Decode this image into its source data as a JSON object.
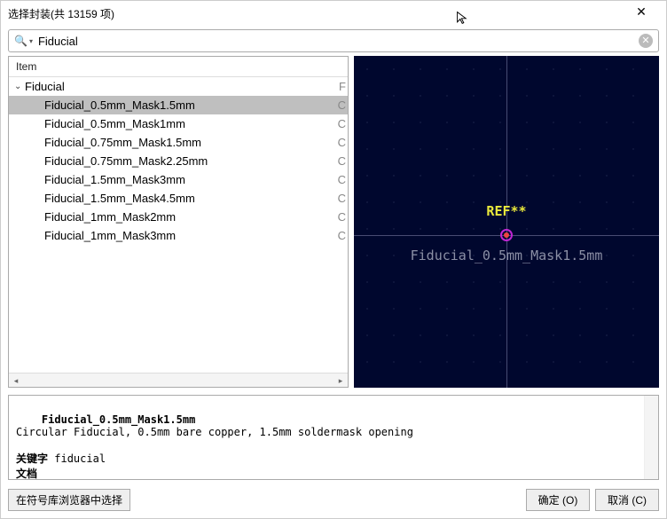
{
  "title": "选择封装(共 13159 项)",
  "search": {
    "value": "Fiducial",
    "placeholder": ""
  },
  "list": {
    "header": "Item",
    "group_name": "Fiducial",
    "items": [
      "Fiducial_0.5mm_Mask1.5mm",
      "Fiducial_0.5mm_Mask1mm",
      "Fiducial_0.75mm_Mask1.5mm",
      "Fiducial_0.75mm_Mask2.25mm",
      "Fiducial_1.5mm_Mask3mm",
      "Fiducial_1.5mm_Mask4.5mm",
      "Fiducial_1mm_Mask2mm",
      "Fiducial_1mm_Mask3mm"
    ],
    "selected_index": 0
  },
  "preview": {
    "ref_label": "REF**",
    "footprint_label": "Fiducial_0.5mm_Mask1.5mm"
  },
  "description": {
    "title": "Fiducial_0.5mm_Mask1.5mm",
    "body": "Circular Fiducial, 0.5mm bare copper, 1.5mm soldermask opening",
    "keywords_label": "关键字",
    "keywords_value": "fiducial",
    "doc_label": "文档"
  },
  "footer": {
    "select_in_browser": "在符号库浏览器中选择",
    "ok": "确定 (O)",
    "cancel": "取消 (C)"
  }
}
